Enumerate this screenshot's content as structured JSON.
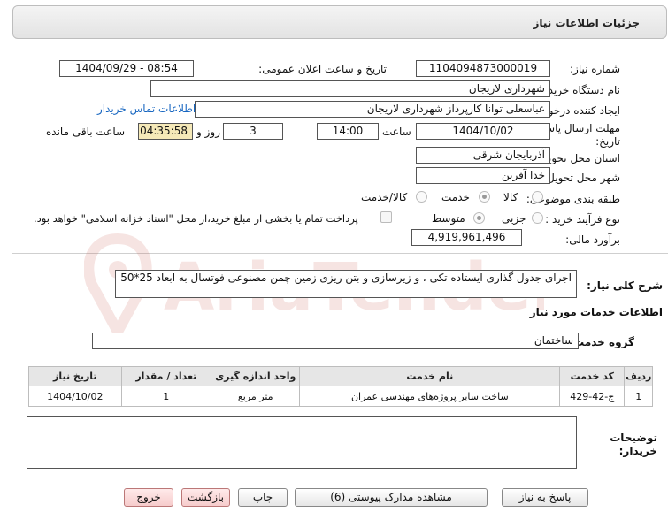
{
  "header": {
    "title": "جزئیات اطلاعات نیاز"
  },
  "fields": {
    "need_number": {
      "label": "شماره نیاز:",
      "value": "1104094873000019"
    },
    "announce_datetime": {
      "label": "تاریخ و ساعت اعلان عمومی:",
      "value": "1404/09/29 - 08:54"
    },
    "buyer_org": {
      "label": "نام دستگاه خریدار:",
      "value": "شهرداری لاریجان"
    },
    "requester": {
      "label": "ایجاد کننده درخواست:",
      "value": "عباسعلی توانا کارپرداز شهرداری لاریجان"
    },
    "buyer_contact_link": "اطلاعات تماس خریدار",
    "deadline": {
      "label_line1": "مهلت ارسال پاسخ: تا",
      "label_line2": "تاریخ:",
      "date": "1404/10/02",
      "time_label": "ساعت",
      "time": "14:00",
      "days": "3",
      "days_label": "روز و",
      "remaining": "04:35:58",
      "remaining_label": "ساعت باقی مانده"
    },
    "province": {
      "label": "استان محل تحویل:",
      "value": "آذربایجان شرقی"
    },
    "city": {
      "label": "شهر محل تحویل:",
      "value": "خدا آفرین"
    },
    "category": {
      "label": "طبقه بندی موضوعی:",
      "options": [
        "کالا",
        "خدمت",
        "کالا/خدمت"
      ],
      "selected": "خدمت"
    },
    "process_type": {
      "label": "نوع فرآیند خرید :",
      "options": [
        "جزیی",
        "متوسط"
      ],
      "selected": "متوسط",
      "payment_note": "پرداخت تمام یا بخشی از مبلغ خرید،از محل \"اسناد خزانه اسلامی\" خواهد بود."
    },
    "budget": {
      "label": "برآورد مالی:",
      "value": "4,919,961,496"
    }
  },
  "description": {
    "label": "شرح کلی نیاز:",
    "value": "اجرای جدول گذاری  ایستاده تکی ، و زیرسازی و بتن ریزی زمین چمن مصنوعی فوتسال به ابعاد 25*50"
  },
  "services": {
    "section_title": "اطلاعات خدمات مورد نیاز",
    "group_label": "گروه خدمت:",
    "group_value": "ساختمان",
    "columns": [
      "ردیف",
      "کد خدمت",
      "نام خدمت",
      "واحد اندازه گیری",
      "تعداد / مقدار",
      "تاریخ نیاز"
    ],
    "rows": [
      [
        "1",
        "ج-42-429",
        "ساخت سایر پروژه‌های مهندسی عمران",
        "متر مربع",
        "1",
        "1404/10/02"
      ]
    ]
  },
  "buyer_notes": {
    "label_line1": "توضیحات",
    "label_line2": "خریدار:",
    "value": ""
  },
  "buttons": {
    "reply": "پاسخ به نیاز",
    "attachments": "مشاهده مدارک پیوستی (6)",
    "print": "چاپ",
    "back": "بازگشت",
    "exit": "خروج"
  },
  "watermark": {
    "text": "AriaTender.neT"
  }
}
